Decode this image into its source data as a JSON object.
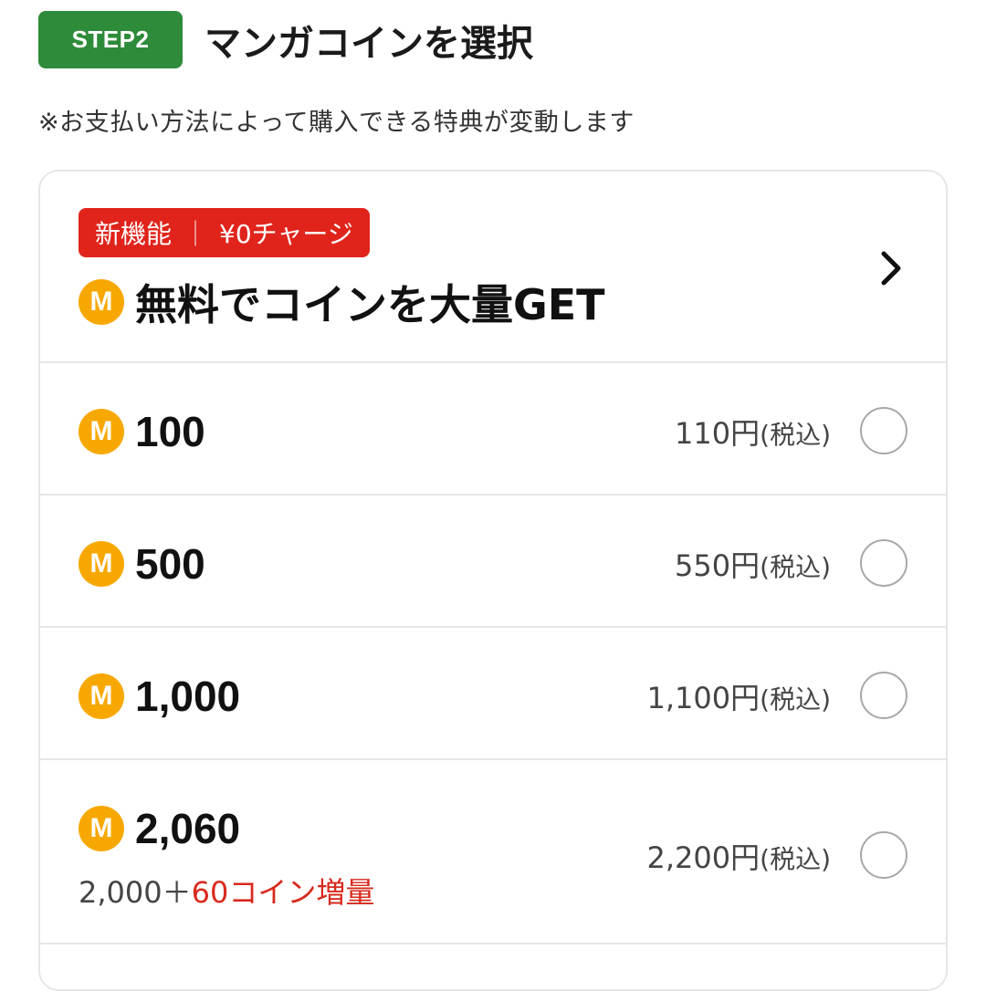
{
  "step": {
    "badge": "STEP2",
    "title": "マンガコインを選択"
  },
  "note": "※お支払い方法によって購入できる特典が変動します",
  "promo": {
    "tag_left": "新機能",
    "tag_sep": "｜",
    "tag_right": "¥0チャージ",
    "coin_icon": "M",
    "text": "無料でコインを大量GET"
  },
  "options": [
    {
      "coin_icon": "M",
      "amount": "100",
      "price": "110円",
      "tax": "(税込)"
    },
    {
      "coin_icon": "M",
      "amount": "500",
      "price": "550円",
      "tax": "(税込)"
    },
    {
      "coin_icon": "M",
      "amount": "1,000",
      "price": "1,100円",
      "tax": "(税込)"
    },
    {
      "coin_icon": "M",
      "amount": "2,060",
      "price": "2,200円",
      "tax": "(税込)",
      "bonus_base": "2,000＋",
      "bonus_extra": "60コイン増量"
    }
  ],
  "colors": {
    "step_green": "#2e8b3a",
    "tag_red": "#e0241b",
    "coin_orange": "#f7a800",
    "bonus_red": "#d72a1e"
  }
}
